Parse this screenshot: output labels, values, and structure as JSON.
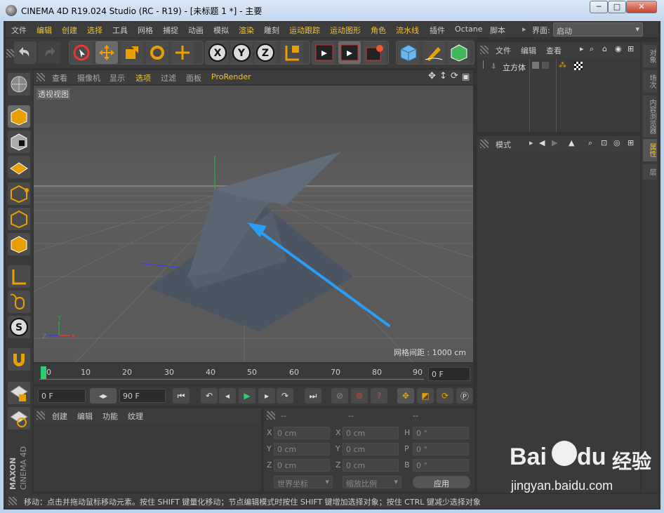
{
  "window": {
    "title": "CINEMA 4D R19.024 Studio (RC - R19) - [未标题 1 *] - 主要",
    "minimize": "─",
    "maximize": "□",
    "close": "✕"
  },
  "menubar": {
    "items": [
      "文件",
      "编辑",
      "创建",
      "选择",
      "工具",
      "网格",
      "捕捉",
      "动画",
      "模拟",
      "渲染",
      "雕刻",
      "运动跟踪",
      "运动图形",
      "角色",
      "流水线",
      "插件",
      "Octane",
      "脚本"
    ],
    "layout_label": "界面:",
    "layout_value": "启动"
  },
  "viewport": {
    "menu": [
      "查看",
      "摄像机",
      "显示",
      "选项",
      "过滤",
      "面板",
      "ProRender"
    ],
    "active_menu": "选项",
    "label": "透视视图",
    "grid_spacing": "网格间距 : 1000 cm",
    "axis_y": "Y",
    "axis_z": "Z",
    "axis_x": "X"
  },
  "timeline": {
    "ticks": [
      "0",
      "10",
      "20",
      "30",
      "40",
      "50",
      "60",
      "70",
      "80",
      "90"
    ],
    "current_frame": "0 F",
    "start_frame": "0 F",
    "end_frame": "90 F"
  },
  "material_panel": {
    "menu": [
      "创建",
      "编辑",
      "功能",
      "纹理"
    ]
  },
  "coord_panel": {
    "headers": [
      "--",
      "--",
      "--"
    ],
    "rows": [
      {
        "l1": "X",
        "v1": "0 cm",
        "l2": "X",
        "v2": "0 cm",
        "l3": "H",
        "v3": "0 °"
      },
      {
        "l1": "Y",
        "v1": "0 cm",
        "l2": "Y",
        "v2": "0 cm",
        "l3": "P",
        "v3": "0 °"
      },
      {
        "l1": "Z",
        "v1": "0 cm",
        "l2": "Z",
        "v2": "0 cm",
        "l3": "B",
        "v3": "0 °"
      }
    ],
    "world_coords": "世界坐标",
    "scale": "缩放比例",
    "apply": "应用"
  },
  "object_manager": {
    "menu": [
      "文件",
      "编辑",
      "查看"
    ],
    "object_name": "立方体"
  },
  "attribute_manager": {
    "mode": "模式"
  },
  "side_tabs": [
    "对象",
    "场次",
    "内容浏览器",
    "属性",
    "层"
  ],
  "active_side_tab": "属性",
  "statusbar": {
    "text": "移动：点击并拖动鼠标移动元素。按住 SHIFT 键量化移动；节点编辑模式时按住 SHIFT 键增加选择对象；按住 CTRL 键减少选择对象"
  },
  "brand": {
    "maxon": "MAXON",
    "cinema": "CINEMA 4D"
  },
  "watermark": {
    "baidu": "Bai",
    "du": "du",
    "jingyan": "经验",
    "url": "jingyan.baidu.com"
  },
  "colors": {
    "accent": "#f1c232",
    "arrow": "#2a9df4",
    "shape": "#4f5866"
  }
}
